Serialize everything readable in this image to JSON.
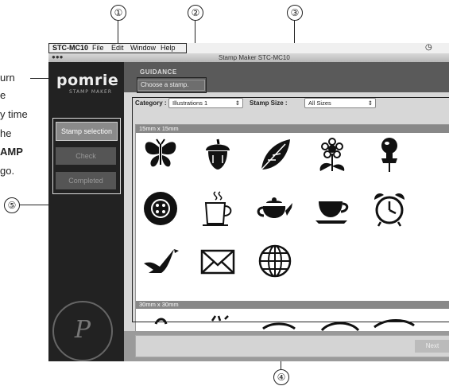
{
  "callouts": [
    "①",
    "②",
    "③",
    "④",
    "⑤"
  ],
  "left_text": {
    "lines": [
      "urn",
      "e",
      "y time",
      "he",
      "AMP",
      "go."
    ]
  },
  "menubar": {
    "app_name": "STC-MC10",
    "items": [
      "File",
      "Edit",
      "Window",
      "Help"
    ]
  },
  "window_title": "Stamp Maker STC-MC10",
  "sidebar": {
    "logo": "pomrie",
    "logo_sub": "STAMP MAKER",
    "steps": [
      "Stamp selection",
      "Check",
      "Completed"
    ]
  },
  "guidance": {
    "label": "GUIDANCE",
    "message": "Choose a stamp."
  },
  "filters": {
    "category_label": "Category :",
    "category_value": "Illustrations 1",
    "size_label": "Stamp Size :",
    "size_value": "All Sizes"
  },
  "sections": [
    "15mm x 15mm",
    "30mm x 30mm"
  ],
  "stamps": [
    "butterfly-icon",
    "acorn-icon",
    "leaf-icon",
    "flower-icon",
    "pushpin-icon",
    "button-icon",
    "coffee-mug-icon",
    "teapot-icon",
    "teacup-icon",
    "alarm-clock-icon",
    "bird-icon",
    "envelope-icon",
    "globe-icon"
  ],
  "footer": {
    "next_label": "Next"
  }
}
